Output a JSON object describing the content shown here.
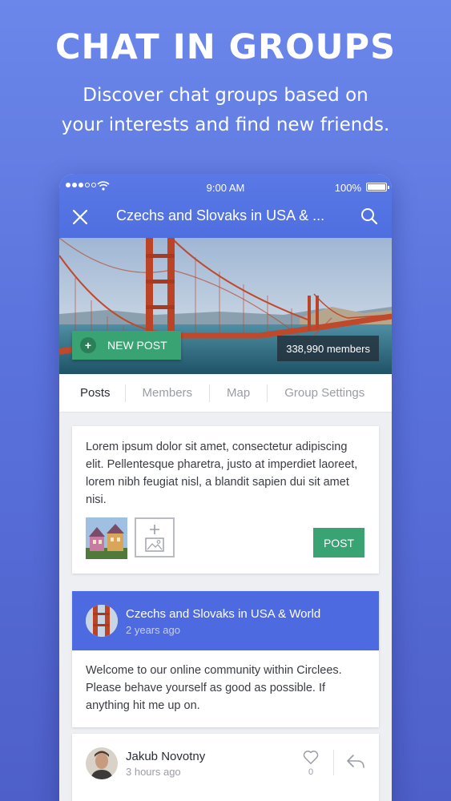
{
  "promo": {
    "headline": "CHAT IN GROUPS",
    "subline_1": "Discover chat groups based on",
    "subline_2": "your interests and find new friends."
  },
  "status_bar": {
    "time": "9:00 AM",
    "battery": "100%"
  },
  "header": {
    "title": "Czechs and Slovaks in USA & ..."
  },
  "hero": {
    "new_post_label": "NEW POST",
    "members": "338,990 members"
  },
  "tabs": [
    {
      "label": "Posts",
      "active": true
    },
    {
      "label": "Members"
    },
    {
      "label": "Map"
    },
    {
      "label": "Group Settings"
    }
  ],
  "composer": {
    "text": "Lorem ipsum dolor sit amet, consectetur adipiscing elit. Pellentesque pharetra, justo at imperdiet laoreet, lorem nibh feugiat nisl, a blandit sapien dui sit amet nisi.",
    "post_label": "POST"
  },
  "feed": [
    {
      "author": "Czechs and Slovaks in USA & World",
      "time": "2 years ago",
      "body": "Welcome to our online community within Circlees. Please behave yourself as good as possible. If anything hit me up on."
    },
    {
      "author": "Jakub Novotny",
      "time": "3 hours ago",
      "likes": "0"
    }
  ],
  "colors": {
    "accent_green": "#3aa374",
    "brand_blue": "#4e6ae0",
    "background": "#6b87ea"
  },
  "icons": [
    "wifi-icon",
    "battery-icon",
    "close-icon",
    "search-icon",
    "plus-icon",
    "add-image-icon",
    "heart-icon",
    "reply-icon"
  ]
}
